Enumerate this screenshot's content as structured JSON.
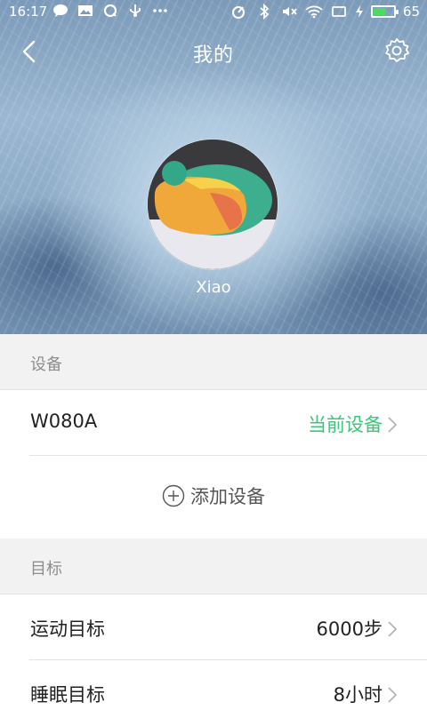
{
  "status_bar": {
    "time": "16:17",
    "battery_level": "65",
    "battery_percent": 65,
    "left_icons": [
      "chat-icon",
      "image-icon",
      "q-icon",
      "usb-icon",
      "more-dots-icon"
    ],
    "right_icons": [
      "nfc-icon",
      "bluetooth-icon",
      "mute-icon",
      "wifi-icon",
      "screen-icon",
      "charging-icon",
      "battery-icon"
    ]
  },
  "nav": {
    "title": "我的",
    "back_icon": "chevron-left-icon",
    "settings_icon": "gear-icon"
  },
  "profile": {
    "username": "Xiao"
  },
  "sections": {
    "device": {
      "header": "设备",
      "device_name": "W080A",
      "device_status": "当前设备",
      "add_label": "添加设备"
    },
    "goal": {
      "header": "目标",
      "exercise_label": "运动目标",
      "exercise_value": "6000步",
      "sleep_label": "睡眠目标",
      "sleep_value": "8小时"
    }
  },
  "colors": {
    "accent_green": "#3fc57a",
    "section_bg": "#f2f2f2"
  }
}
